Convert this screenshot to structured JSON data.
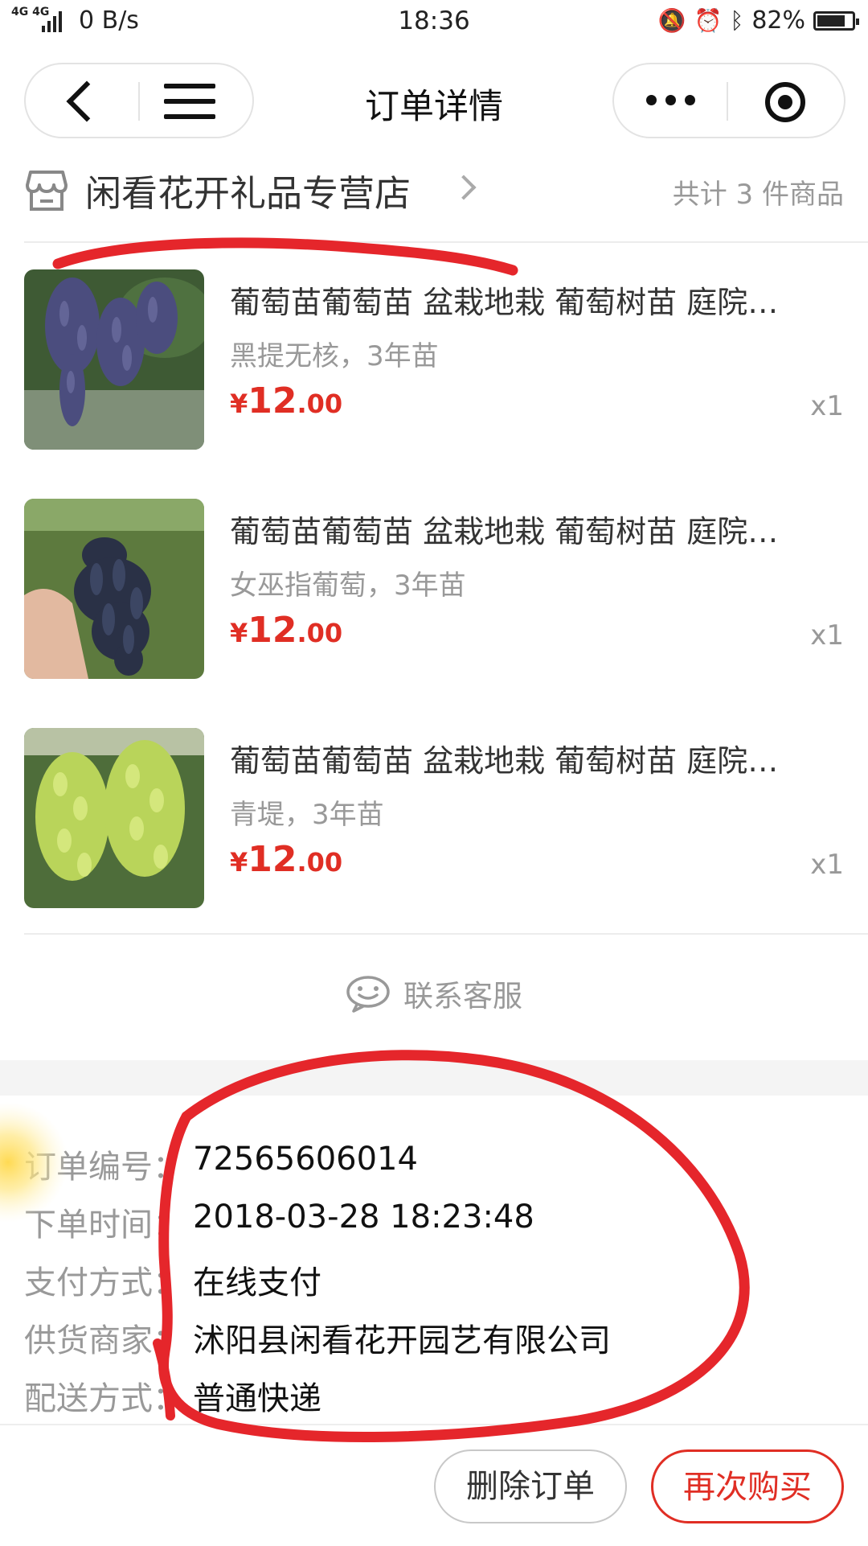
{
  "status_bar": {
    "network": "4G 4G",
    "speed": "0 B/s",
    "time": "18:36",
    "battery": "82%",
    "battery_level": 0.82
  },
  "nav": {
    "title": "订单详情"
  },
  "shop": {
    "name": "闲看花开礼品专营店",
    "count_text": "共计 3 件商品"
  },
  "products": [
    {
      "title": "葡萄苗葡萄苗 盆栽地栽 葡萄树苗 庭院…",
      "spec": "黑提无核，3年苗",
      "price_currency": "¥",
      "price_int": "12",
      "price_dec": ".00",
      "qty": "x1"
    },
    {
      "title": "葡萄苗葡萄苗 盆栽地栽 葡萄树苗 庭院…",
      "spec": "女巫指葡萄，3年苗",
      "price_currency": "¥",
      "price_int": "12",
      "price_dec": ".00",
      "qty": "x1"
    },
    {
      "title": "葡萄苗葡萄苗 盆栽地栽 葡萄树苗 庭院…",
      "spec": "青堤，3年苗",
      "price_currency": "¥",
      "price_int": "12",
      "price_dec": ".00",
      "qty": "x1"
    }
  ],
  "contact": {
    "label": "联系客服"
  },
  "order_info": [
    {
      "label": "订单编号：",
      "value": "72565606014"
    },
    {
      "label": "下单时间：",
      "value": "2018-03-28 18:23:48"
    },
    {
      "label": "支付方式：",
      "value": "在线支付"
    },
    {
      "label": "供货商家：",
      "value": "沭阳县闲看花开园艺有限公司"
    },
    {
      "label": "配送方式：",
      "value": "普通快递"
    }
  ],
  "actions": {
    "delete_label": "删除订单",
    "rebuy_label": "再次购买"
  },
  "colors": {
    "price_red": "#e02e24",
    "annotation_red": "#e5262b",
    "muted_gray": "#999999"
  }
}
